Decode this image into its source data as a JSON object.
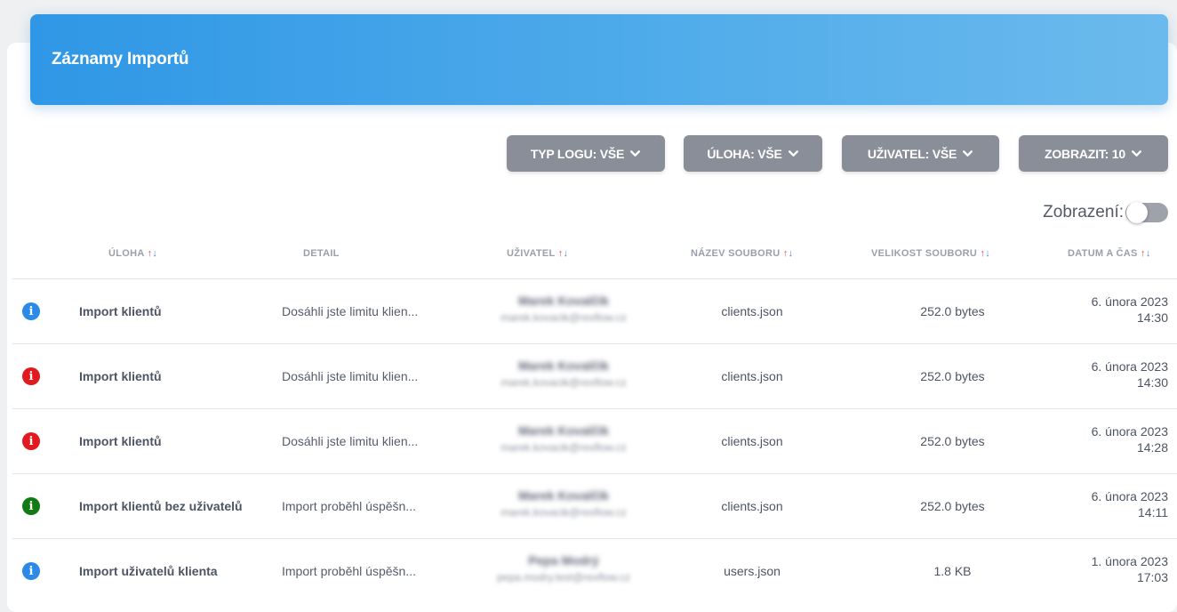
{
  "header": {
    "title": "Záznamy Importů"
  },
  "filters": [
    {
      "label": "TYP LOGU: VŠE"
    },
    {
      "label": "ÚLOHA: VŠE"
    },
    {
      "label": "UŽIVATEL: VŠE"
    },
    {
      "label": "ZOBRAZIT: 10"
    }
  ],
  "view_toggle": {
    "label": "Zobrazení:"
  },
  "sort_arrows": {
    "up": "↑",
    "down": "↓"
  },
  "columns": {
    "task": "ÚLOHA",
    "detail": "DETAIL",
    "user": "UŽIVATEL",
    "file": "NÁZEV SOUBORU",
    "size": "VELIKOST SOUBORU",
    "datetime": "DATUM A ČAS"
  },
  "status_colors": {
    "info": "#2b8ae8",
    "error": "#e2191f",
    "success": "#117a12"
  },
  "rows": [
    {
      "status": "info",
      "status_icon": "info-icon",
      "task": "Import klientů",
      "detail": "Dosáhli jste limitu klien...",
      "user_name": "Marek Kovalčík",
      "user_email": "marek.kovacik@rexflow.cz",
      "file": "clients.json",
      "size": "252.0 bytes",
      "date": "6. února 2023",
      "time": "14:30"
    },
    {
      "status": "error",
      "status_icon": "error-icon",
      "task": "Import klientů",
      "detail": "Dosáhli jste limitu klien...",
      "user_name": "Marek Kovalčík",
      "user_email": "marek.kovacik@rexflow.cz",
      "file": "clients.json",
      "size": "252.0 bytes",
      "date": "6. února 2023",
      "time": "14:30"
    },
    {
      "status": "error",
      "status_icon": "error-icon",
      "task": "Import klientů",
      "detail": "Dosáhli jste limitu klien...",
      "user_name": "Marek Kovalčík",
      "user_email": "marek.kovacik@rexflow.cz",
      "file": "clients.json",
      "size": "252.0 bytes",
      "date": "6. února 2023",
      "time": "14:28"
    },
    {
      "status": "success",
      "status_icon": "success-icon",
      "task": "Import klientů bez uživatelů",
      "detail": "Import proběhl úspěšn...",
      "user_name": "Marek Kovalčík",
      "user_email": "marek.kovacik@rexflow.cz",
      "file": "clients.json",
      "size": "252.0 bytes",
      "date": "6. února 2023",
      "time": "14:11"
    },
    {
      "status": "info",
      "status_icon": "info-icon",
      "task": "Import uživatelů klienta",
      "detail": "Import proběhl úspěšn...",
      "user_name": "Pepa Modrý",
      "user_email": "pepa.modry.test@rexflow.cz",
      "file": "users.json",
      "size": "1.8 KB",
      "date": "1. února 2023",
      "time": "17:03"
    }
  ]
}
